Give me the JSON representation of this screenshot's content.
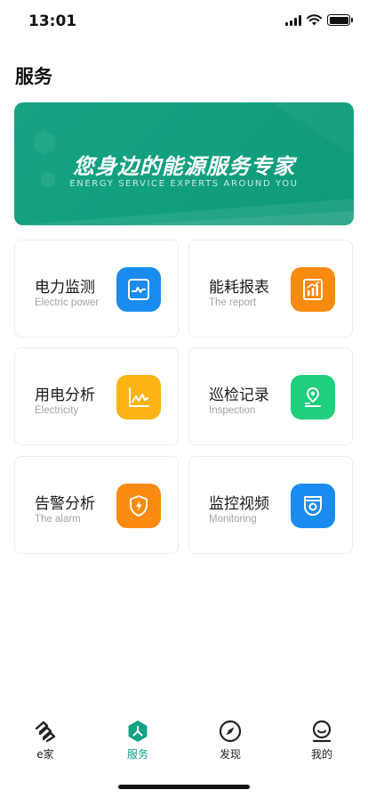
{
  "status_bar": {
    "time": "13:01"
  },
  "page": {
    "title": "服务"
  },
  "banner": {
    "title": "您身边的能源服务专家",
    "subtitle": "ENERGY SERVICE EXPERTS AROUND YOU"
  },
  "services": [
    {
      "title": "电力监测",
      "subtitle": "Electric power",
      "icon": "monitor-wave-icon",
      "color": "#1a8cf0"
    },
    {
      "title": "能耗报表",
      "subtitle": "The report",
      "icon": "report-chart-icon",
      "color": "#fb8a10"
    },
    {
      "title": "用电分析",
      "subtitle": "Electricity",
      "icon": "line-chart-icon",
      "color": "#fcb314"
    },
    {
      "title": "巡检记录",
      "subtitle": "Inspection",
      "icon": "location-pin-icon",
      "color": "#1fcf7c"
    },
    {
      "title": "告警分析",
      "subtitle": "The alarm",
      "icon": "shield-bolt-icon",
      "color": "#fb8a10"
    },
    {
      "title": "监控视频",
      "subtitle": "Monitoring",
      "icon": "camera-icon",
      "color": "#1a8cf0"
    }
  ],
  "tabbar": {
    "tabs": [
      {
        "label": "e家",
        "icon": "e-home-icon",
        "active": false
      },
      {
        "label": "服务",
        "icon": "service-hex-icon",
        "active": true
      },
      {
        "label": "发现",
        "icon": "compass-icon",
        "active": false
      },
      {
        "label": "我的",
        "icon": "profile-icon",
        "active": false
      }
    ],
    "active_color": "#11a183"
  }
}
